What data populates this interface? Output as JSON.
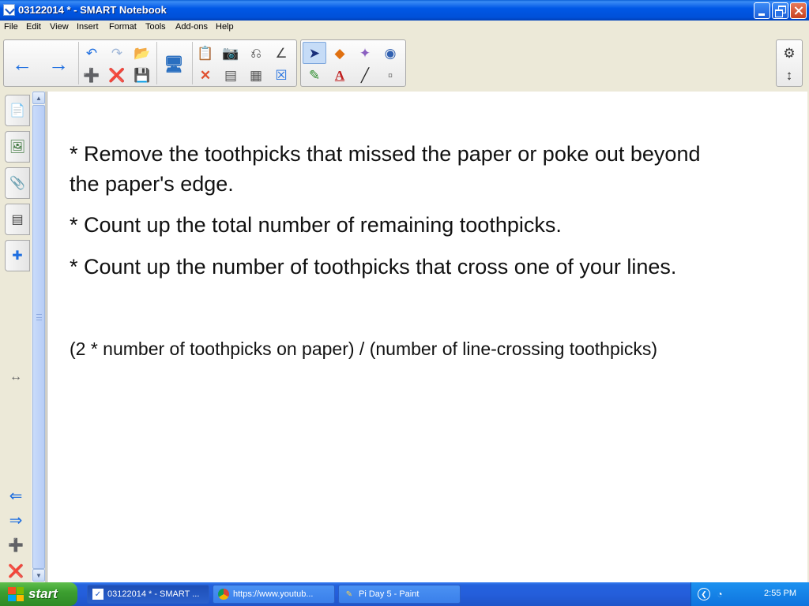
{
  "window": {
    "title": "03122014 * - SMART Notebook"
  },
  "menu": [
    "File",
    "Edit",
    "View",
    "Insert",
    "Format",
    "Tools",
    "Add-ons",
    "Help"
  ],
  "toolbar": {
    "icons": [
      "back-arrow-icon",
      "forward-arrow-icon",
      "undo-icon",
      "redo-icon",
      "new-page-icon",
      "delete-page-icon",
      "open-file-icon",
      "save-icon",
      "screen-view-icon",
      "paste-icon",
      "delete-icon",
      "screen-shade-icon",
      "table-icon",
      "capture-icon",
      "fullscreen-icon",
      "properties-icon",
      "measurement-tools-icon",
      "select-icon",
      "pens-icon",
      "creative-pens-icon",
      "text-icon",
      "eraser-icon",
      "line-icon",
      "shapes-icon",
      "magic-pen-icon",
      "fill-icon",
      "settings-gear-icon",
      "move-toolbar-icon"
    ]
  },
  "sidebar": {
    "tabs": [
      "page-sorter-icon",
      "gallery-icon",
      "attachments-icon",
      "properties-icon",
      "addons-icon"
    ]
  },
  "notes": {
    "line1": "* Remove the toothpicks that missed the paper or poke out beyond",
    "line2": "the paper's edge.",
    "line3": "* Count up the total number of remaining toothpicks.",
    "line4": "* Count up the number of toothpicks that cross one of your lines.",
    "formula": "(2 * number of toothpicks on paper) / (number of line-crossing toothpicks)"
  },
  "taskbar": {
    "start_label": "start",
    "tasks": [
      {
        "label": "03122014 * - SMART ..."
      },
      {
        "label": "https://www.youtub..."
      },
      {
        "label": "Pi Day 5 - Paint"
      }
    ],
    "clock": "2:55 PM"
  },
  "colors": {
    "title_bar": "#0058E6",
    "taskbar": "#245EDB",
    "start_green": "#3C9F30",
    "tray_blue": "#0F74DE"
  }
}
